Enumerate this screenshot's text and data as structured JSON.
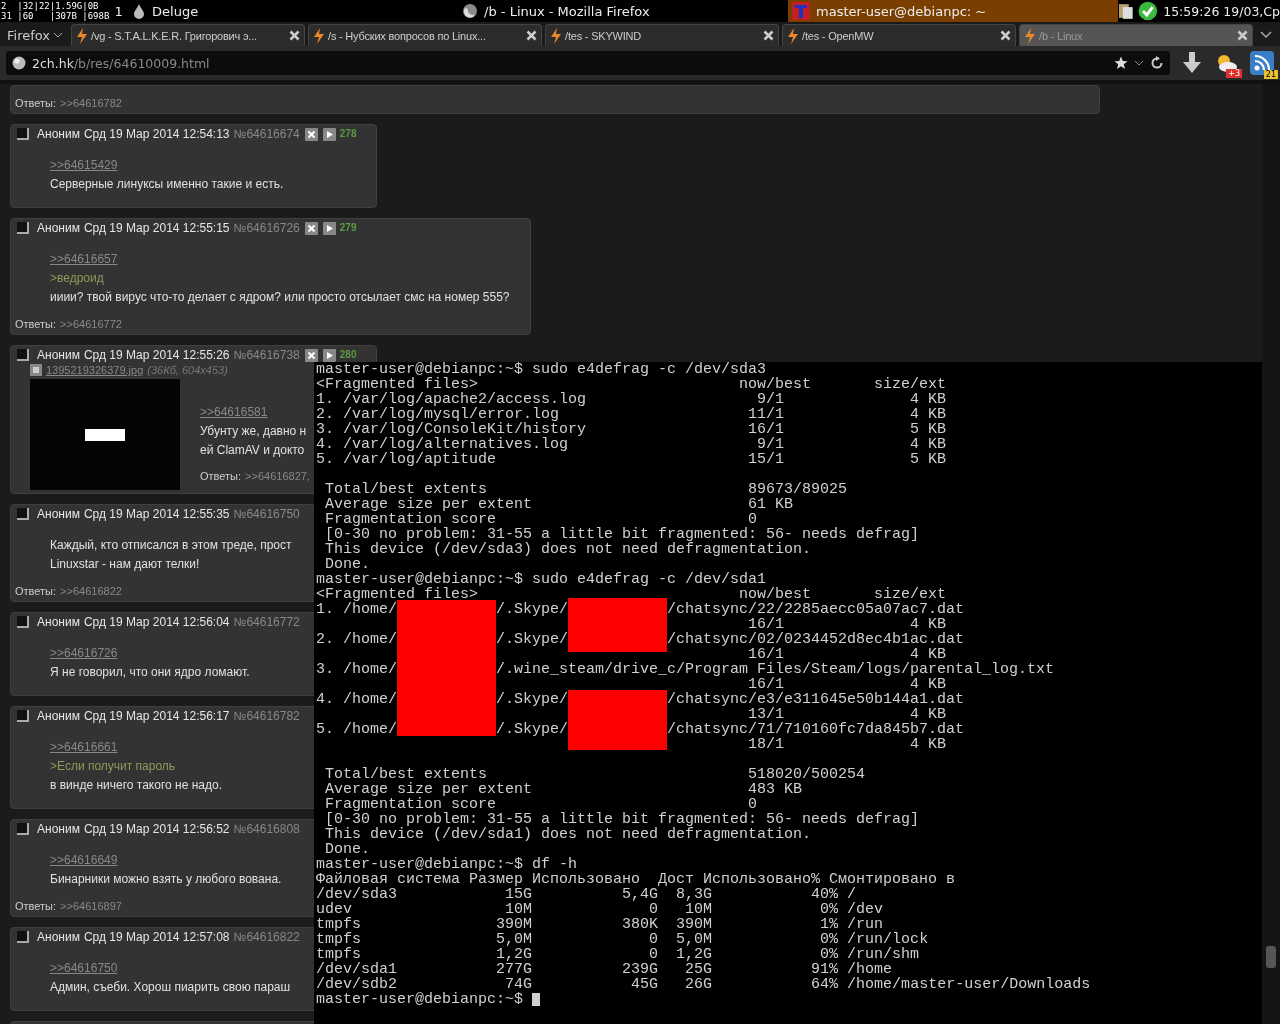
{
  "panel": {
    "sysmon": [
      "2  |32|22|1.59G|0B",
      "31 |60   |307B |698B"
    ],
    "workspace": "1",
    "tasks": [
      {
        "label": "Deluge",
        "kind": "deluge",
        "selected": false
      },
      {
        "label": "/b - Linux - Mozilla Firefox",
        "kind": "firefox",
        "selected": false
      },
      {
        "label": "master-user@debianpc: ~",
        "kind": "terminal",
        "selected": true
      }
    ],
    "clock": "15:59:26 19/03,Ср"
  },
  "browser": {
    "menu_button": "Firefox",
    "tabs": [
      {
        "label": "/vg - S.T.A.L.K.E.R. Григорович э...",
        "selected": false
      },
      {
        "label": "/s - Нубских вопросов по Linux...",
        "selected": false
      },
      {
        "label": "/tes - SKYWIND",
        "selected": false
      },
      {
        "label": "/tes - OpenMW",
        "selected": false
      },
      {
        "label": "/b - Linux",
        "selected": true
      }
    ],
    "url": {
      "host": "2ch.hk",
      "path": "/b/res/64610009.html"
    },
    "badges": {
      "weather": "+3",
      "feeds": "21"
    }
  },
  "thread": {
    "posts": [
      {
        "replies_label": "Ответы:",
        "replies": ">>64616782"
      },
      {
        "checked": false,
        "name": "Аноним",
        "date": "Срд 19 Мар 2014 12:54:13",
        "number": "№64616674",
        "controls": true,
        "count": "278",
        "body": [
          {
            "kind": "link",
            "text": ">>64615429"
          },
          {
            "kind": "text",
            "text": "Серверные линуксы именно такие и есть."
          }
        ]
      },
      {
        "checked": false,
        "name": "Аноним",
        "date": "Срд 19 Мар 2014 12:55:15",
        "number": "№64616726",
        "controls": true,
        "count": "279",
        "body": [
          {
            "kind": "link",
            "text": ">>64616657"
          },
          {
            "kind": "quote",
            "text": ">ведроид"
          },
          {
            "kind": "text",
            "text": "ииии? твой вирус что-то делает с ядром? или просто отсылает смс на номер 555?"
          }
        ],
        "replies_label": "Ответы:",
        "replies": ">>64616772"
      },
      {
        "checked": false,
        "name": "Аноним",
        "date": "Срд 19 Мар 2014 12:55:26",
        "number": "№64616738",
        "controls": true,
        "count": "280",
        "file": {
          "name": "1395219326379.jpg",
          "meta": "(36Кб, 604x453)"
        },
        "body": [
          {
            "kind": "link",
            "text": ">>64616581"
          },
          {
            "kind": "text",
            "text": "Убунту же, давно н"
          },
          {
            "kind": "text",
            "text": "ей ClamAV и докто"
          }
        ],
        "replies_label": "Ответы:",
        "replies": ">>64616827,"
      },
      {
        "checked": false,
        "name": "Аноним",
        "date": "Срд 19 Мар 2014 12:55:35",
        "number": "№64616750",
        "controls": false,
        "body": [
          {
            "kind": "text",
            "text": "Каждый, кто отписался в этом треде, прост"
          },
          {
            "kind": "text",
            "text": "Linuxstar - нам дают телки!"
          }
        ],
        "replies_label": "Ответы:",
        "replies": ">>64616822"
      },
      {
        "checked": false,
        "name": "Аноним",
        "date": "Срд 19 Мар 2014 12:56:04",
        "number": "№64616772",
        "controls": false,
        "body": [
          {
            "kind": "link",
            "text": ">>64616726"
          },
          {
            "kind": "text",
            "text": "Я не говорил, что они ядро ломают."
          }
        ]
      },
      {
        "checked": false,
        "name": "Аноним",
        "date": "Срд 19 Мар 2014 12:56:17",
        "number": "№64616782",
        "controls": false,
        "body": [
          {
            "kind": "link",
            "text": ">>64616661"
          },
          {
            "kind": "quote",
            "text": ">Если получит пароль"
          },
          {
            "kind": "text",
            "text": "в винде ничего такого не надо."
          }
        ]
      },
      {
        "checked": false,
        "name": "Аноним",
        "date": "Срд 19 Мар 2014 12:56:52",
        "number": "№64616808",
        "controls": false,
        "body": [
          {
            "kind": "link",
            "text": ">>64616649"
          },
          {
            "kind": "text",
            "text": "Бинарники можно взять у любого вована."
          }
        ],
        "replies_label": "Ответы:",
        "replies": ">>64616897"
      },
      {
        "checked": false,
        "name": "Аноним",
        "date": "Срд 19 Мар 2014 12:57:08",
        "number": "№64616822",
        "controls": false,
        "body": [
          {
            "kind": "link",
            "text": ">>64616750"
          },
          {
            "kind": "text",
            "text": "Админ, съеби. Хорош пиарить свою параш"
          }
        ]
      }
    ]
  },
  "terminal": {
    "blocks": [
      [
        "master-user@debianpc:~$ sudo e4defrag -c /dev/sda3",
        "<Fragmented files>                             now/best       size/ext",
        "1. /var/log/apache2/access.log                   9/1              4 KB",
        "2. /var/log/mysql/error.log                     11/1              4 KB",
        "3. /var/log/ConsoleKit/history                  16/1              5 KB",
        "4. /var/log/alternatives.log                     9/1              4 KB",
        "5. /var/log/aptitude                            15/1              5 KB"
      ],
      [
        " Total/best extents                             89673/89025",
        " Average size per extent                        61 KB",
        " Fragmentation score                            0",
        " [0-30 no problem: 31-55 a little bit fragmented: 56- needs defrag]",
        " This device (/dev/sda3) does not need defragmentation.",
        " Done.",
        "master-user@debianpc:~$ sudo e4defrag -c /dev/sda1",
        "<Fragmented files>                             now/best       size/ext",
        "1. /home/           /.Skype/           /chatsync/22/2285aecc05a07ac7.dat",
        "                                                16/1              4 KB",
        "2. /home/           /.Skype/           /chatsync/02/0234452d8ec4b1ac.dat",
        "                                                16/1              4 KB",
        "3. /home/           /.wine_steam/drive_c/Program Files/Steam/logs/parental_log.txt",
        "                                                16/1              4 KB",
        "4. /home/           /.Skype/           /chatsync/e3/e311645e50b144a1.dat",
        "                                                13/1              4 KB",
        "5. /home/           /.Skype/           /chatsync/71/710160fc7da845b7.dat",
        "                                                18/1              4 KB"
      ],
      [
        " Total/best extents                             518020/500254",
        " Average size per extent                        483 KB",
        " Fragmentation score                            0",
        " [0-30 no problem: 31-55 a little bit fragmented: 56- needs defrag]",
        " This device (/dev/sda1) does not need defragmentation.",
        " Done.",
        "master-user@debianpc:~$ df -h",
        "Файловая система Размер Использовано  Дост Использовано% Смонтировано в",
        "/dev/sda3            15G          5,4G  8,3G           40% /",
        "udev                 10M             0   10M            0% /dev",
        "tmpfs               390M          380K  390M            1% /run",
        "tmpfs               5,0M             0  5,0M            0% /run/lock",
        "tmpfs               1,2G             0  1,2G            0% /run/shm",
        "/dev/sda1           277G          239G   25G           91% /home",
        "/dev/sdb2            74G           45G   26G           64% /home/master-user/Downloads"
      ]
    ],
    "prompt": "master-user@debianpc:~$"
  }
}
